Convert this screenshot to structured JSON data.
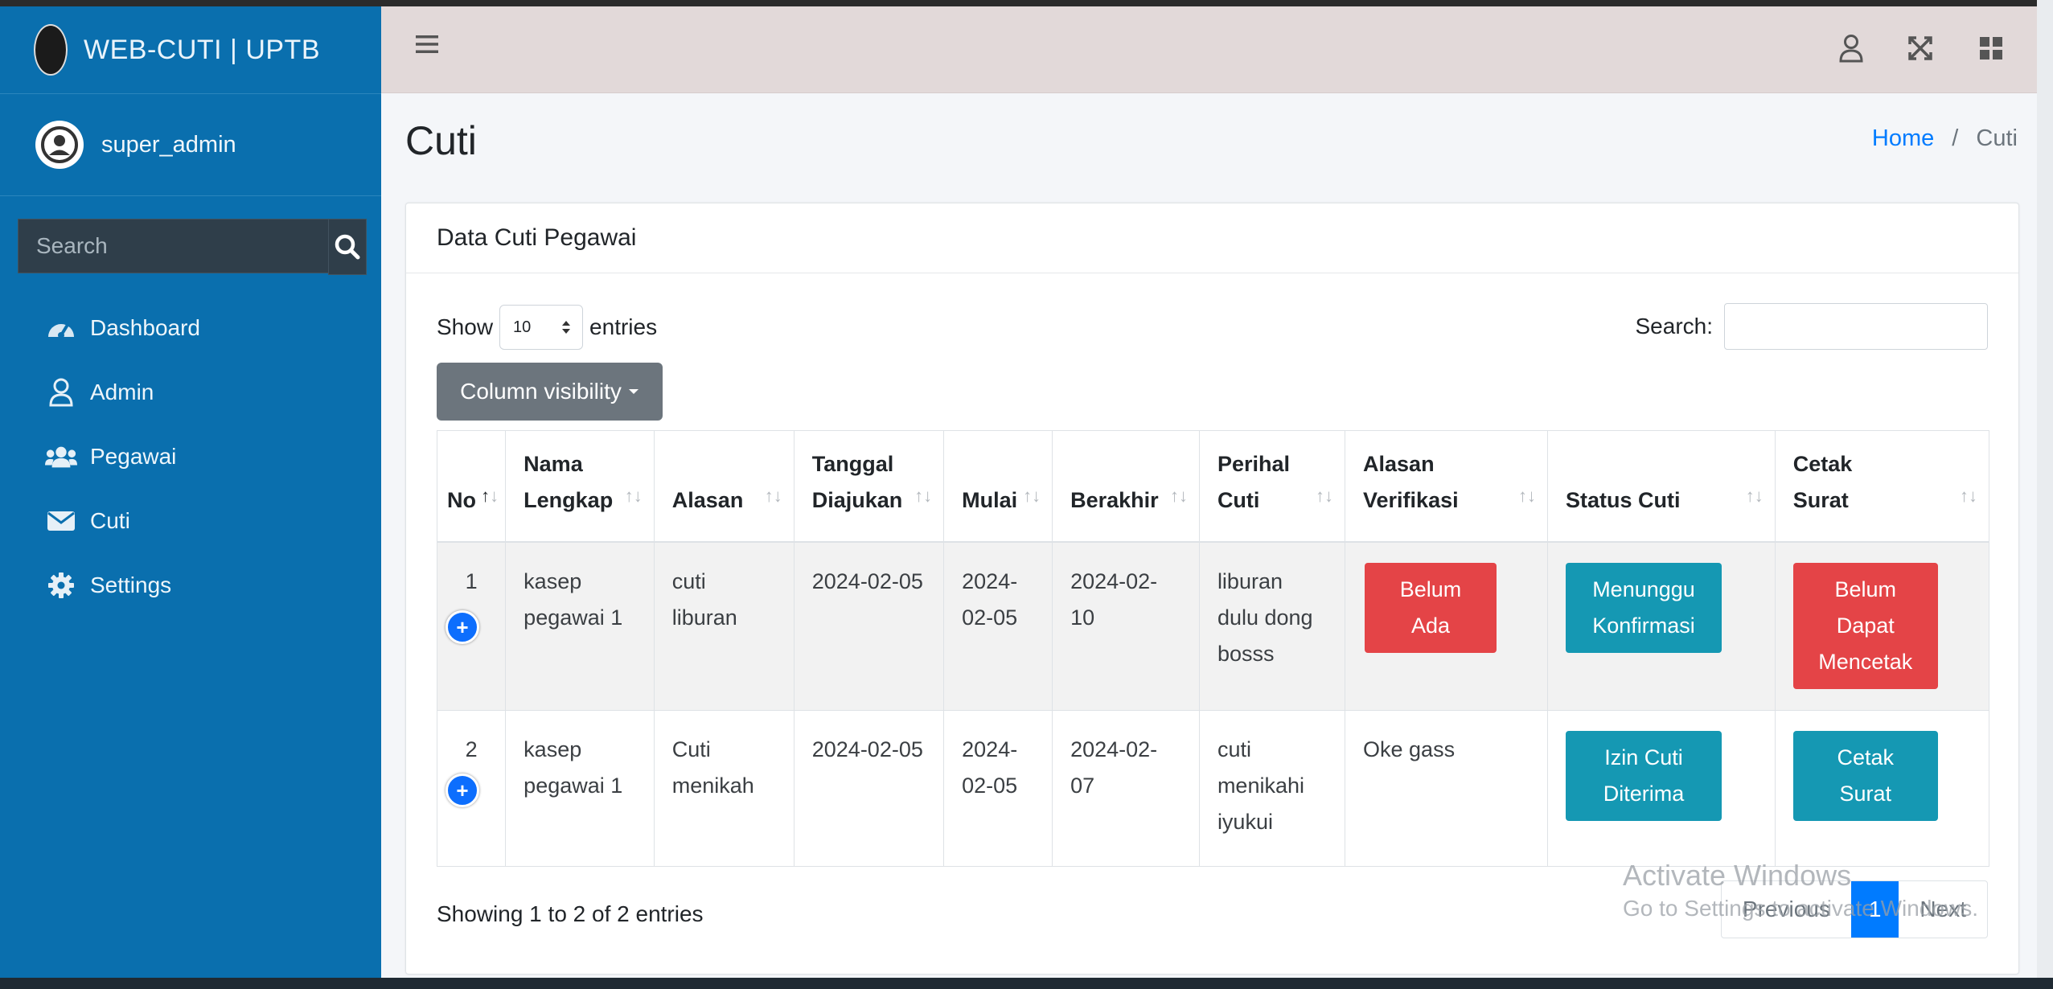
{
  "brand": {
    "title": "WEB-CUTI | UPTB"
  },
  "user": {
    "name": "super_admin"
  },
  "sidebar_search": {
    "placeholder": "Search"
  },
  "nav": [
    {
      "label": "Dashboard",
      "icon": "dashboard-icon"
    },
    {
      "label": "Admin",
      "icon": "user-icon"
    },
    {
      "label": "Pegawai",
      "icon": "users-icon"
    },
    {
      "label": "Cuti",
      "icon": "envelope-icon"
    },
    {
      "label": "Settings",
      "icon": "gear-icon"
    }
  ],
  "page": {
    "title": "Cuti"
  },
  "breadcrumb": {
    "home": "Home",
    "sep": "/",
    "current": "Cuti"
  },
  "card": {
    "title": "Data Cuti Pegawai"
  },
  "length": {
    "show": "Show",
    "value": "10",
    "entries": "entries"
  },
  "filter": {
    "label": "Search:"
  },
  "colvis": {
    "label": "Column visibility"
  },
  "table": {
    "headers": {
      "no": "No",
      "nama": [
        "Nama",
        "Lengkap"
      ],
      "alasan": "Alasan",
      "tanggal": [
        "Tanggal",
        "Diajukan"
      ],
      "mulai": "Mulai",
      "berakhir": "Berakhir",
      "perihal": [
        "Perihal",
        "Cuti"
      ],
      "verifikasi": [
        "Alasan",
        "Verifikasi"
      ],
      "status": "Status Cuti",
      "cetak": [
        "Cetak",
        "Surat"
      ]
    },
    "rows": [
      {
        "no": "1",
        "nama": [
          "kasep",
          "pegawai 1"
        ],
        "alasan": [
          "cuti",
          "liburan"
        ],
        "tanggal": "2024-02-05",
        "mulai": "2024-02-05",
        "berakhir": "2024-02-10",
        "perihal": [
          "liburan",
          "dulu dong",
          "bosss"
        ],
        "verifikasi": [
          "Belum",
          "Ada"
        ],
        "status": [
          "Menunggu",
          "Konfirmasi"
        ],
        "cetak": [
          "Belum",
          "Dapat",
          "Mencetak"
        ]
      },
      {
        "no": "2",
        "nama": [
          "kasep",
          "pegawai 1"
        ],
        "alasan": [
          "Cuti",
          "menikah"
        ],
        "tanggal": "2024-02-05",
        "mulai": "2024-02-05",
        "berakhir": "2024-02-07",
        "perihal": [
          "cuti",
          "menikahi",
          "iyukui"
        ],
        "verifikasi": "Oke gass",
        "status": [
          "Izin Cuti",
          "Diterima"
        ],
        "cetak": [
          "Cetak",
          "Surat"
        ]
      }
    ]
  },
  "info": "Showing 1 to 2 of 2 entries",
  "pagination": {
    "previous": "Previous",
    "current": "1",
    "next": "Next"
  },
  "watermark": {
    "line1": "Activate Windows",
    "line2": "Go to Settings to activate Windows."
  },
  "colors": {
    "sidebar": "#0a6fae",
    "header": "#e2d9d9",
    "danger": "#e44447",
    "info": "#1598b3",
    "primary": "#007bff",
    "secondary": "#6c757d"
  }
}
